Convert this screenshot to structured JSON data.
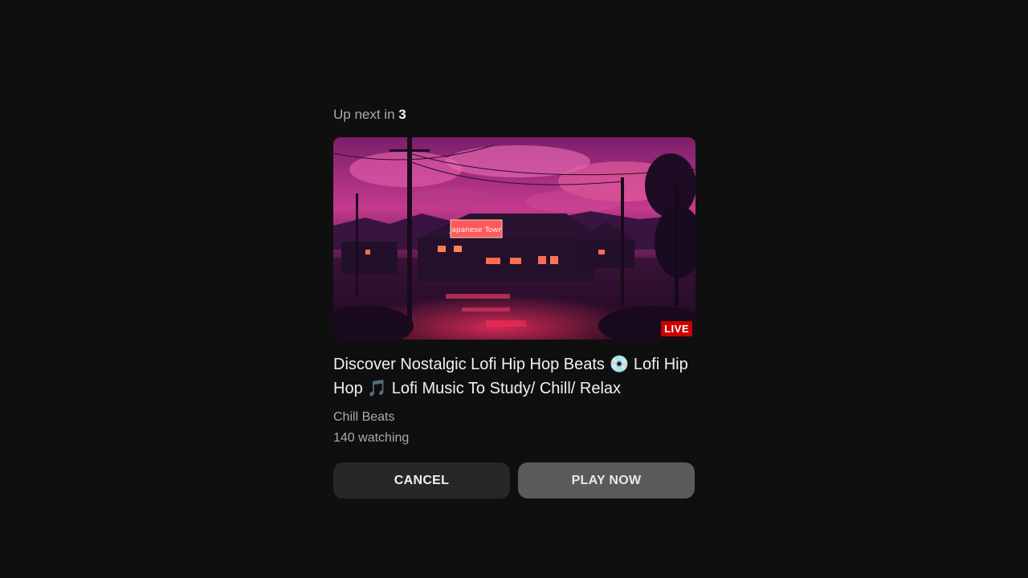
{
  "up_next": {
    "prefix": "Up next in",
    "countdown": "3"
  },
  "video": {
    "thumbnail_sign": "Japanese Town",
    "live_badge": "LIVE",
    "title": "Discover Nostalgic Lofi Hip Hop Beats 💿 Lofi Hip Hop 🎵 Lofi Music To Study/ Chill/ Relax",
    "channel": "Chill Beats",
    "watching": "140 watching"
  },
  "buttons": {
    "cancel": "CANCEL",
    "play_now": "PLAY NOW"
  },
  "colors": {
    "background": "#0f0f0f",
    "live_badge": "#cc0000",
    "cancel_button": "#272727",
    "play_button": "#5a5a5a",
    "primary_text": "#f1f1f1",
    "secondary_text": "#aaaaaa"
  }
}
